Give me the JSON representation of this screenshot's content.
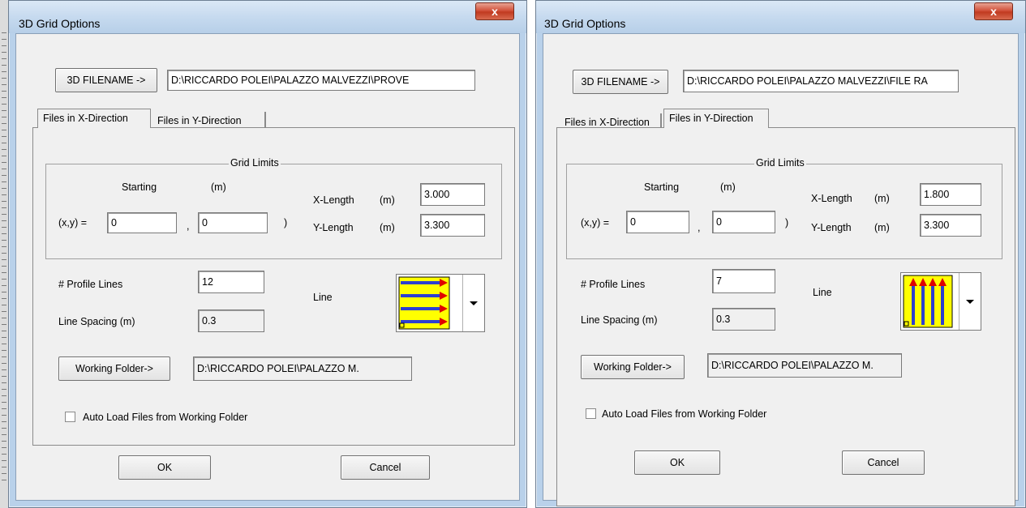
{
  "left_dialog": {
    "title": "3D Grid Options",
    "close_glyph": "x",
    "filename_button": "3D FILENAME ->",
    "filename_value": "D:\\RICCARDO POLEI\\PALAZZO MALVEZZI\\PROVE",
    "tabs": [
      "Files in X-Direction",
      "Files in Y-Direction"
    ],
    "active_tab": "Files in X-Direction",
    "grid_limits_title": "Grid Limits",
    "starting_label": "Starting",
    "units_label": "(m)",
    "xy_label": "(x,y) =",
    "start_x": "0",
    "start_y": "0",
    "comma": ",",
    "close_paren": ")",
    "x_length_label": "X-Length",
    "x_length_unit": "(m)",
    "x_length": "3.000",
    "y_length_label": "Y-Length",
    "y_length_unit": "(m)",
    "y_length": "3.300",
    "profile_lines_label": "# Profile Lines",
    "profile_lines": "12",
    "line_label": "Line",
    "line_direction_icon": "horizontal-arrows-icon",
    "line_spacing_label": "Line Spacing  (m)",
    "line_spacing": "0.3",
    "working_folder_button": "Working Folder->",
    "working_folder_value": "D:\\RICCARDO POLEI\\PALAZZO M.",
    "auto_load_label": "Auto Load Files from Working Folder",
    "auto_load_checked": false,
    "ok_button": "OK",
    "cancel_button": "Cancel"
  },
  "right_dialog": {
    "title": "3D Grid Options",
    "close_glyph": "x",
    "filename_button": "3D FILENAME ->",
    "filename_value": "D:\\RICCARDO POLEI\\PALAZZO MALVEZZI\\FILE RA",
    "tabs": [
      "Files in X-Direction",
      "Files in Y-Direction"
    ],
    "active_tab": "Files in Y-Direction",
    "grid_limits_title": "Grid Limits",
    "starting_label": "Starting",
    "units_label": "(m)",
    "xy_label": "(x,y) =",
    "start_x": "0",
    "start_y": "0",
    "comma": ",",
    "close_paren": ")",
    "x_length_label": "X-Length",
    "x_length_unit": "(m)",
    "x_length": "1.800",
    "y_length_label": "Y-Length",
    "y_length_unit": "(m)",
    "y_length": "3.300",
    "profile_lines_label": "# Profile Lines",
    "profile_lines": "7",
    "line_label": "Line",
    "line_direction_icon": "vertical-arrows-icon",
    "line_spacing_label": "Line Spacing  (m)",
    "line_spacing": "0.3",
    "working_folder_button": "Working Folder->",
    "working_folder_value": "D:\\RICCARDO POLEI\\PALAZZO M.",
    "auto_load_label": "Auto Load Files from Working Folder",
    "auto_load_checked": false,
    "ok_button": "OK",
    "cancel_button": "Cancel"
  },
  "colors": {
    "title_bar": "#c6daef",
    "close_button": "#c13a20",
    "dialog_face": "#f0f0f0",
    "line_icon_fill": "#ffff00",
    "arrow_line": "#2d3fd0",
    "arrow_head": "#e00000"
  }
}
